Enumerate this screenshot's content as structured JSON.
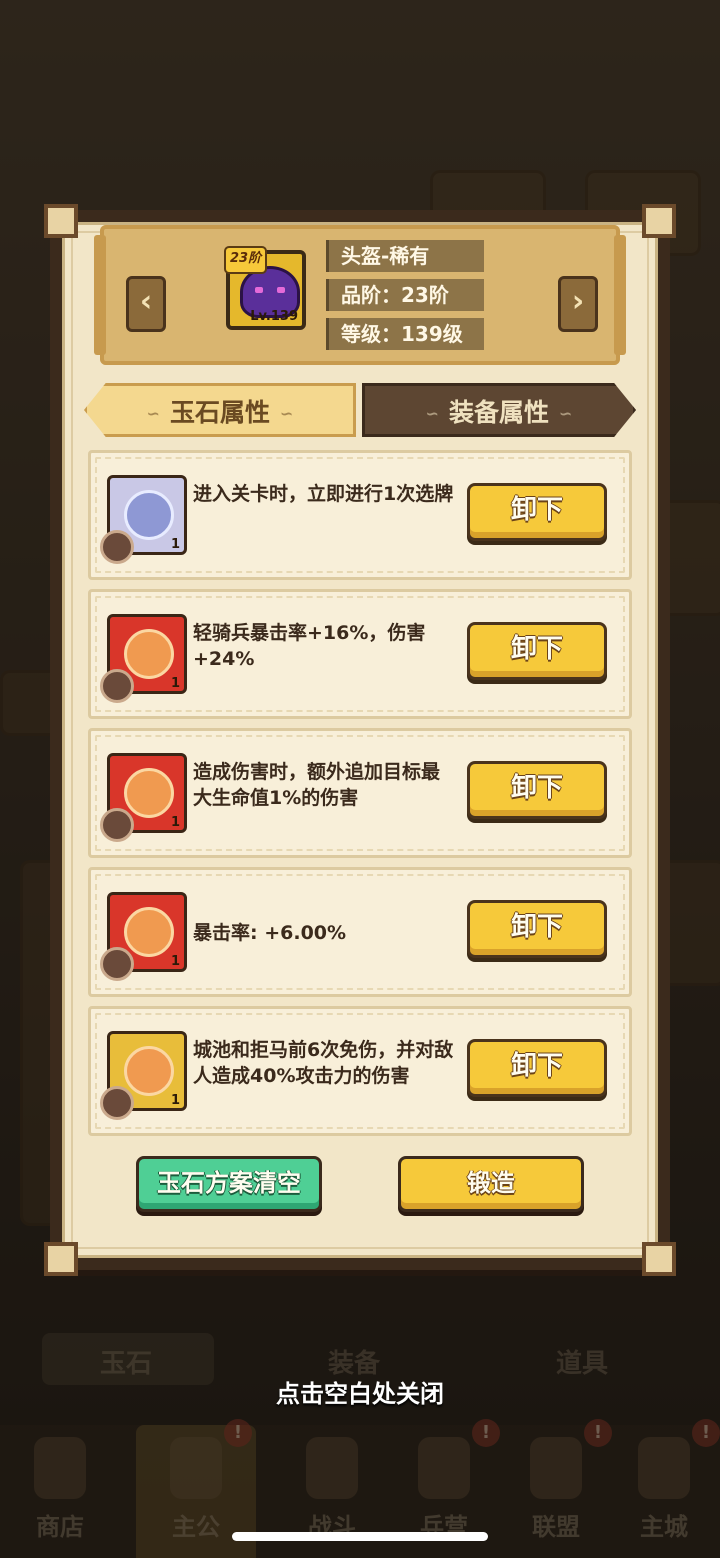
{
  "equipment": {
    "tier_badge": "23阶",
    "level_badge": "Lv.139",
    "name": "头盔-稀有",
    "grade": "品阶：23阶",
    "level": "等级：139级"
  },
  "tabs": {
    "jade": "玉石属性",
    "equipment": "装备属性"
  },
  "slots": [
    {
      "gem": "white-dragon-jade",
      "count": "1",
      "description": "进入关卡时，立即进行1次选牌",
      "button": "卸下"
    },
    {
      "gem": "red-swirl-jade",
      "count": "1",
      "description": "轻骑兵暴击率+16%，伤害+24%",
      "button": "卸下"
    },
    {
      "gem": "red-swirl-jade",
      "count": "1",
      "description": "造成伤害时，额外追加目标最大生命值1%的伤害",
      "button": "卸下"
    },
    {
      "gem": "red-swirl-jade",
      "count": "1",
      "description": "暴击率: +6.00%",
      "button": "卸下"
    },
    {
      "gem": "gold-swirl-jade",
      "count": "1",
      "description": "城池和拒马前6次免伤，并对敌人造成40%攻击力的伤害",
      "button": "卸下"
    }
  ],
  "footer": {
    "clear_button": "玉石方案清空",
    "forge_button": "锻造"
  },
  "close_hint": "点击空白处关闭",
  "background": {
    "inventory_tabs": [
      "玉石",
      "装备",
      "道具"
    ],
    "nav": [
      "商店",
      "主公",
      "战斗",
      "兵营",
      "联盟",
      "主城"
    ],
    "nav_active": "主公"
  },
  "colors": {
    "button_yellow": "#f6c93a",
    "button_green": "#4fcf95",
    "panel": "#f2e6c8",
    "frame": "#3b2a1c"
  }
}
